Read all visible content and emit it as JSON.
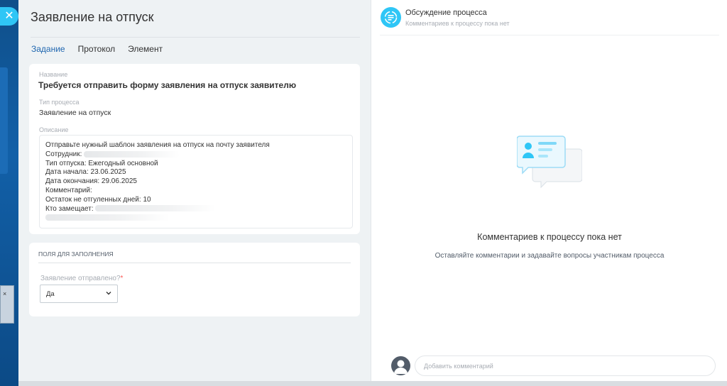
{
  "outer": {
    "close_icon": "close-icon",
    "mini_close": "×"
  },
  "page": {
    "title": "Заявление на отпуск",
    "tabs": [
      {
        "label": "Задание",
        "active": true
      },
      {
        "label": "Протокол",
        "active": false
      },
      {
        "label": "Элемент",
        "active": false
      }
    ]
  },
  "task": {
    "name_label": "Название",
    "name_value": "Требуется отправить форму заявления на отпуск заявителю",
    "process_type_label": "Тип процесса",
    "process_type_value": "Заявление на отпуск",
    "description_label": "Описание",
    "description_lines": [
      "Отправьте нужный шаблон заявления на отпуск на почту заявителя",
      "Сотрудник:",
      "Тип отпуска: Ежегодный основной",
      "Дата начала: 23.06.2025",
      "Дата окончания: 29.06.2025",
      "Комментарий:",
      "Остаток не отгуленных дней: 10",
      "Кто замещает:"
    ]
  },
  "fields": {
    "section_title": "ПОЛЯ ДЛЯ ЗАПОЛНЕНИЯ",
    "question_label": "Заявление отправлено?",
    "required_mark": "*",
    "selected_value": "Да"
  },
  "discussion": {
    "title": "Обсуждение процесса",
    "subtitle": "Комментариев к процессу пока нет",
    "empty_title": "Комментариев к процессу пока нет",
    "empty_text": "Оставляйте комментарии и задавайте вопросы участникам процесса",
    "comment_placeholder": "Добавить комментарий"
  },
  "colors": {
    "accent": "#2fc6f6",
    "active_tab": "#2067b0",
    "required": "#ff5752"
  }
}
